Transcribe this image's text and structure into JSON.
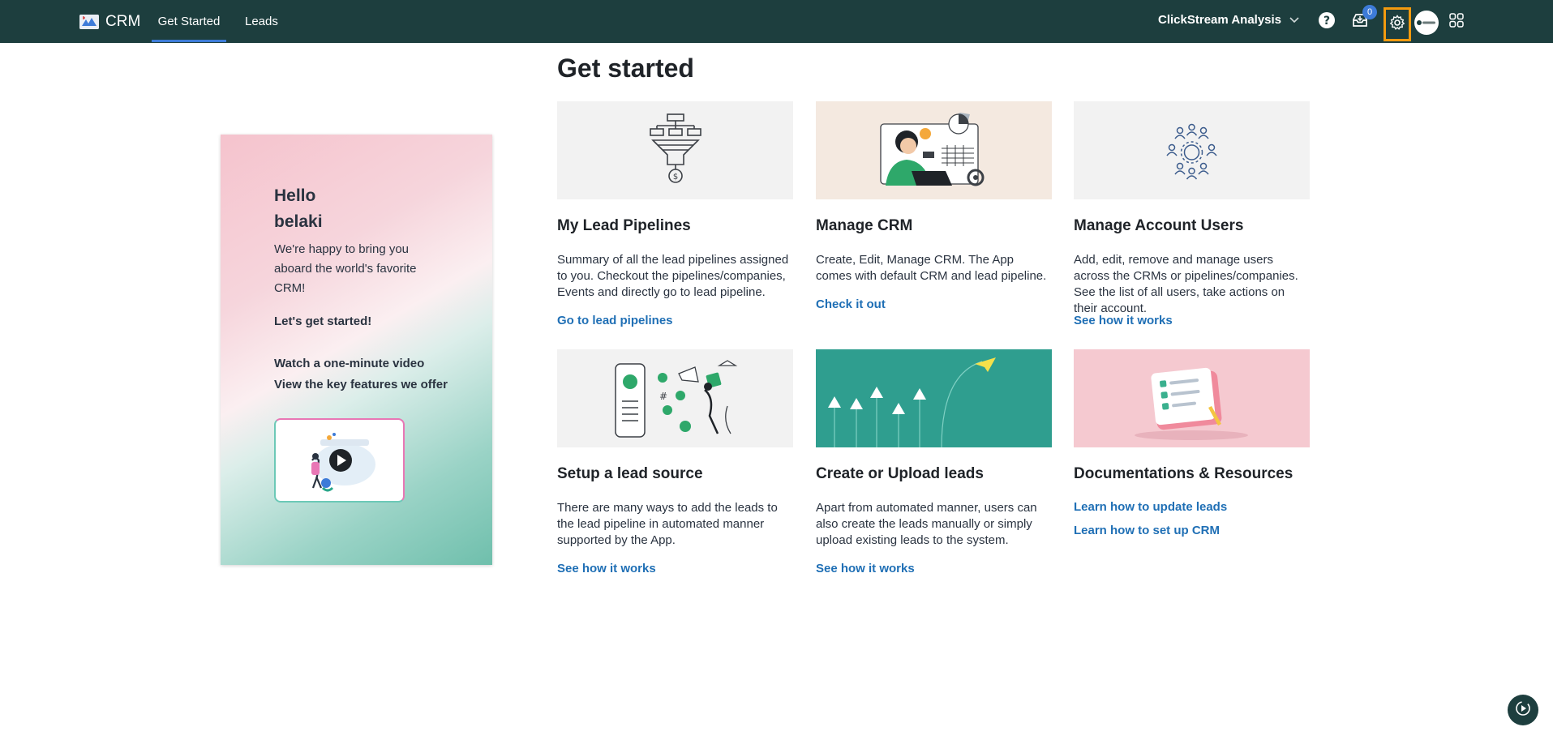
{
  "header": {
    "brand": "CRM",
    "tabs": [
      {
        "label": "Get Started",
        "active": true
      },
      {
        "label": "Leads",
        "active": false
      }
    ],
    "org_name": "ClickStream Analysis",
    "inbox_count": "0",
    "icons": [
      "help-icon",
      "inbox-icon",
      "gear-icon",
      "avatar",
      "apps-grid-icon"
    ],
    "accent_color": "#3d7bd8",
    "highlight_color": "#f29a0f",
    "bar_color": "#1d3e3e"
  },
  "page": {
    "title": "Get started"
  },
  "welcome": {
    "hello": "Hello",
    "name": "belaki",
    "text": "We're happy to bring you aboard the world's favorite CRM!",
    "lets_start": "Let's get started!",
    "watch_video": "Watch a one-minute video",
    "view_features": "View the key features we offer"
  },
  "cards": [
    {
      "title": "My Lead Pipelines",
      "description": "Summary of all the lead pipelines assigned to you. Checkout the pipelines/companies, Events and directly go to lead pipeline.",
      "links": [
        "Go to lead pipelines"
      ]
    },
    {
      "title": "Manage CRM",
      "description": "Create, Edit, Manage CRM. The App comes with default CRM and lead pipeline.",
      "links": [
        "Check it out"
      ]
    },
    {
      "title": "Manage Account Users",
      "description": "Add, edit, remove and manage users across the CRMs or pipelines/companies. See the list of all users, take actions on their account.",
      "links": [
        "See how it works"
      ]
    },
    {
      "title": "Setup a lead source",
      "description": "There are many ways to add the leads to the lead pipeline in automated manner supported by the App.",
      "links": [
        "See how it works"
      ]
    },
    {
      "title": "Create or Upload leads",
      "description": "Apart from automated manner, users can also create the leads manually or simply upload existing leads to the system.",
      "links": [
        "See how it works"
      ]
    },
    {
      "title": "Documentations & Resources",
      "description": "",
      "links": [
        "Learn how to update leads",
        "Learn how to set up CRM"
      ]
    }
  ],
  "link_color": "#1f6fb5"
}
